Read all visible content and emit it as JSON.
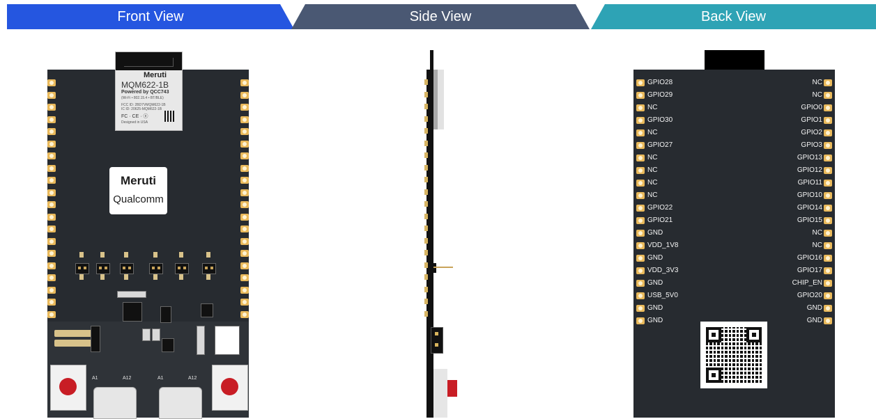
{
  "tabs": {
    "front": "Front View",
    "side": "Side View",
    "back": "Back View"
  },
  "colors": {
    "front_tab": "#2556e0",
    "side_tab": "#4a5873",
    "back_tab": "#2ea3b5",
    "board": "#272b30",
    "pad": "#e9b95b",
    "button_red": "#c81d25"
  },
  "module": {
    "brand": "Meruti",
    "model": "MQM622-1B",
    "powered_by": "Powered by QCC743",
    "features": "(Wi-Fi • 802.15.4 • BT/BLE)",
    "fcc_id": "FCC ID: 2BD7VMQM622-1B",
    "ic_id": "IC ID: 20625-MQM622-1B",
    "marks": "FC · CE · ⓔ",
    "designed": "Designed in USA"
  },
  "logo_card": {
    "meruti": "Meruti",
    "qualcomm": "Qualcomm"
  },
  "usb_labels": [
    "A1",
    "A12",
    "A1",
    "A12"
  ],
  "back_pins": {
    "left": [
      "GPIO28",
      "GPIO29",
      "NC",
      "GPIO30",
      "NC",
      "GPIO27",
      "NC",
      "NC",
      "NC",
      "NC",
      "GPIO22",
      "GPIO21",
      "GND",
      "VDD_1V8",
      "GND",
      "VDD_3V3",
      "GND",
      "USB_5V0",
      "GND",
      "GND"
    ],
    "right": [
      "NC",
      "NC",
      "GPIO0",
      "GPIO1",
      "GPIO2",
      "GPIO3",
      "GPIO13",
      "GPIO12",
      "GPIO11",
      "GPIO10",
      "GPIO14",
      "GPIO15",
      "NC",
      "NC",
      "GPIO16",
      "GPIO17",
      "CHIP_EN",
      "GPIO20",
      "GND",
      "GND"
    ]
  }
}
